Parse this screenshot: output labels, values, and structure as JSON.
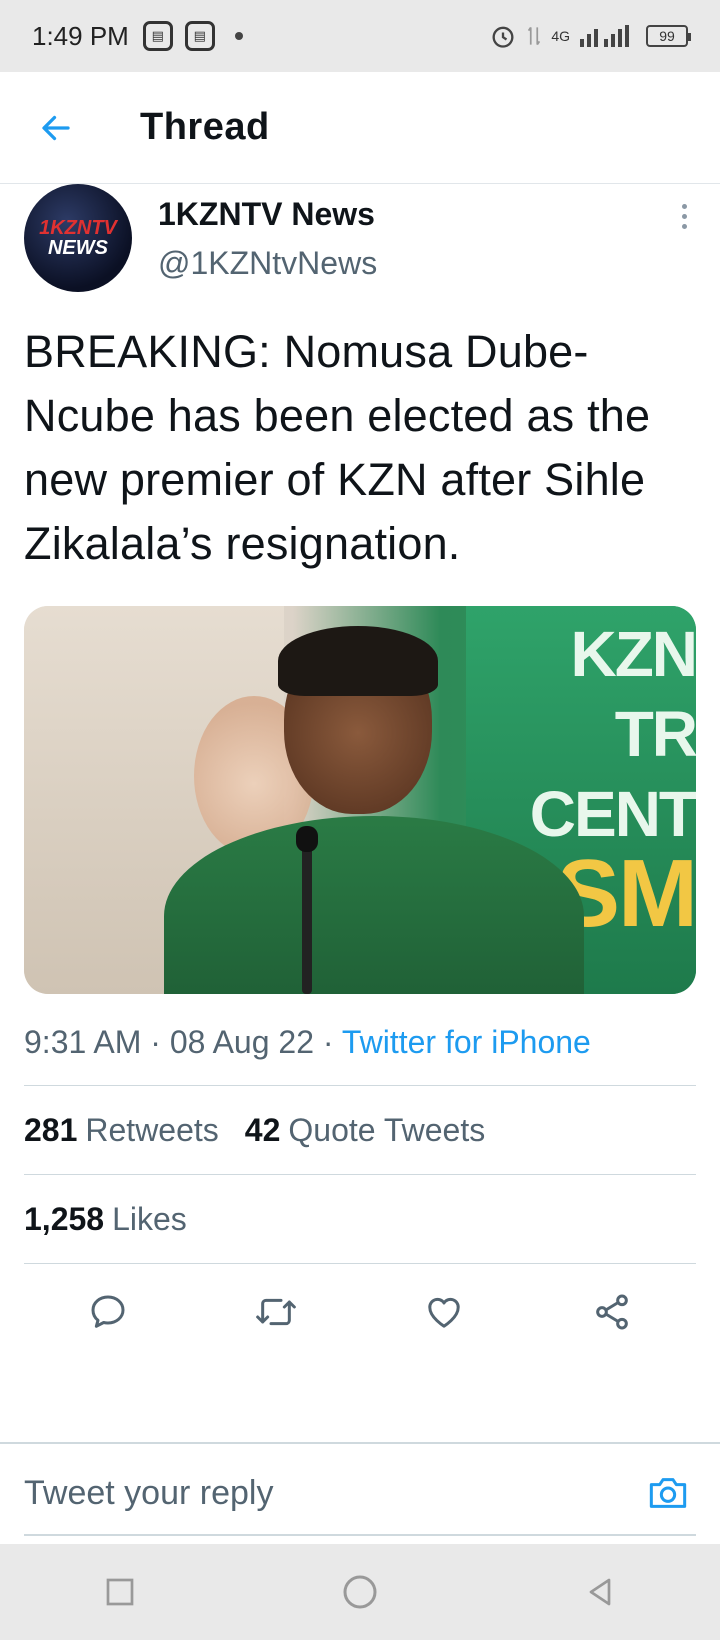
{
  "status_bar": {
    "time": "1:49 PM",
    "battery": "99",
    "network": "4G"
  },
  "header": {
    "title": "Thread",
    "back_icon": "arrow-left-icon"
  },
  "tweet": {
    "author": {
      "name": "1KZNTV News",
      "handle": "@1KZNtvNews",
      "avatar_text_top": "1KZNTV",
      "avatar_text_bottom": "NEWS"
    },
    "text": "BREAKING: Nomusa Dube-Ncube has been elected as the new premier of KZN after Sihle Zikalala’s resignation.",
    "media": {
      "signage_line1": "KZN TR",
      "signage_line2": "CENT",
      "signage_line3": "SM"
    },
    "timestamp": "9:31 AM · 08 Aug 22 ·",
    "source": "Twitter for iPhone",
    "stats": {
      "retweets_count": "281",
      "retweets_label": "Retweets",
      "quotes_count": "42",
      "quotes_label": "Quote Tweets",
      "likes_count": "1,258",
      "likes_label": "Likes"
    },
    "actions": [
      "reply-icon",
      "retweet-icon",
      "like-icon",
      "share-icon"
    ]
  },
  "reply": {
    "placeholder": "Tweet your reply",
    "camera_icon": "camera-icon"
  },
  "colors": {
    "accent": "#1d9bf0",
    "secondary_text": "#536471",
    "primary_text": "#0f1419"
  }
}
